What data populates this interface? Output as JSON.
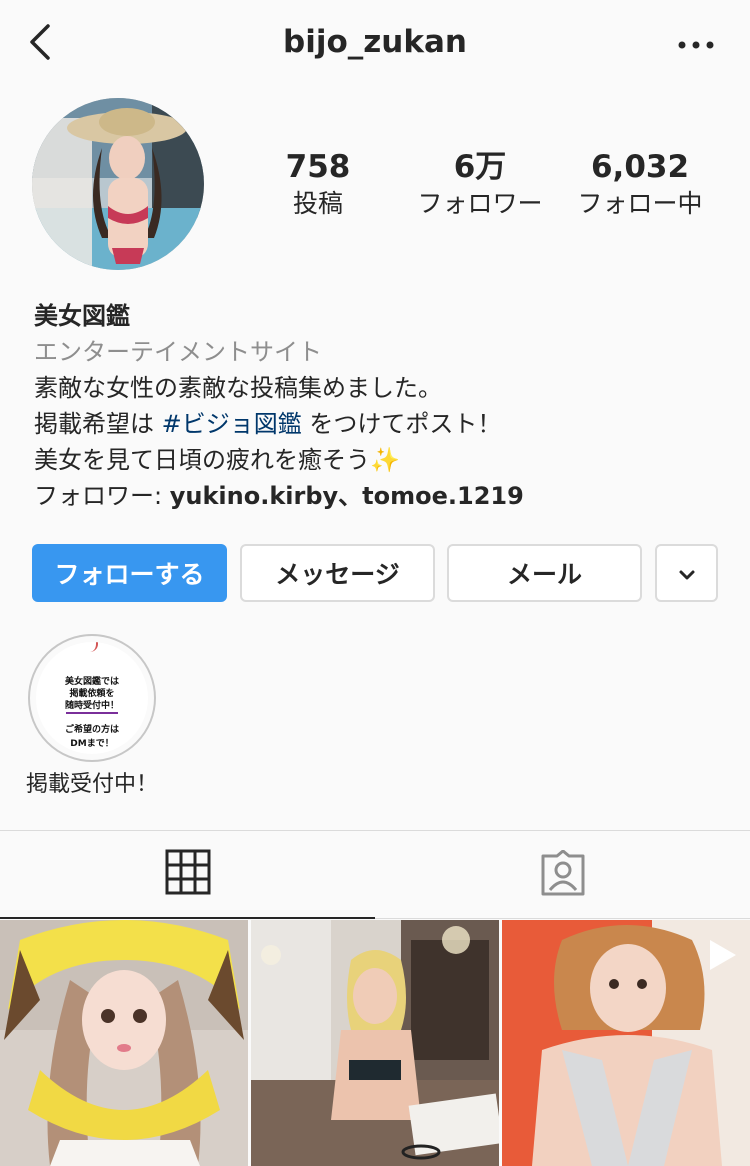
{
  "header": {
    "username": "bijo_zukan",
    "back_icon": "chevron-left-icon",
    "more_icon": "more-horizontal-icon"
  },
  "profile": {
    "avatar_icon": "profile-avatar",
    "stats": {
      "posts_count": "758",
      "posts_label": "投稿",
      "followers_count": "6万",
      "followers_label": "フォロワー",
      "following_count": "6,032",
      "following_label": "フォロー中"
    }
  },
  "bio": {
    "name": "美女図鑑",
    "category": "エンターテイメントサイト",
    "line1": "素敵な女性の素敵な投稿集めました。",
    "line2_prefix": "掲載希望は ",
    "line2_hashtag": "#ビジョ図鑑",
    "line2_suffix": " をつけてポスト！",
    "line3": "美女を見て日頃の疲れを癒そう✨",
    "followed_by_prefix": "フォロワー: ",
    "followed_by_names": "yukino.kirby、tomoe.1219"
  },
  "actions": {
    "follow_label": "フォローする",
    "message_label": "メッセージ",
    "mail_label": "メール",
    "dropdown_icon": "chevron-down-icon"
  },
  "highlights": [
    {
      "label": "掲載受付中！",
      "cover_line1": "美女図鑑では",
      "cover_line2": "掲載依頼を",
      "cover_line3": "随時受付中！",
      "cover_line4": "ご希望の方は",
      "cover_line5": "DMまで！"
    }
  ],
  "tabs": {
    "grid_icon": "grid-icon",
    "tagged_icon": "tagged-person-icon"
  },
  "colors": {
    "accent": "#3897f0",
    "hashtag": "#00376b",
    "secondary_text": "#8e8e8e",
    "border": "#dbdbdb"
  },
  "posts": [
    {
      "icon": "post-thumbnail"
    },
    {
      "icon": "post-thumbnail"
    },
    {
      "icon": "post-thumbnail",
      "badge_icon": "video-play-icon"
    }
  ]
}
